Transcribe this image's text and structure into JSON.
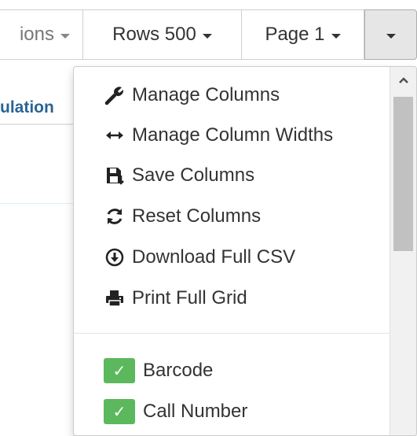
{
  "toolbar": {
    "options_label": "ions",
    "rows_label": "Rows 500",
    "page_label": "Page 1"
  },
  "grid": {
    "header_partial": "ulation"
  },
  "menu": {
    "actions": [
      {
        "label": "Manage Columns",
        "icon": "wrench-icon"
      },
      {
        "label": "Manage Column Widths",
        "icon": "arrows-horizontal-icon"
      },
      {
        "label": "Save Columns",
        "icon": "save-icon"
      },
      {
        "label": "Reset Columns",
        "icon": "refresh-icon"
      },
      {
        "label": "Download Full CSV",
        "icon": "download-circle-icon"
      },
      {
        "label": "Print Full Grid",
        "icon": "print-icon"
      }
    ],
    "columns": [
      {
        "label": "Barcode",
        "checked": true
      },
      {
        "label": "Call Number",
        "checked": true
      }
    ]
  },
  "colors": {
    "check_green": "#5cb85c",
    "link_blue": "#2a6496"
  }
}
